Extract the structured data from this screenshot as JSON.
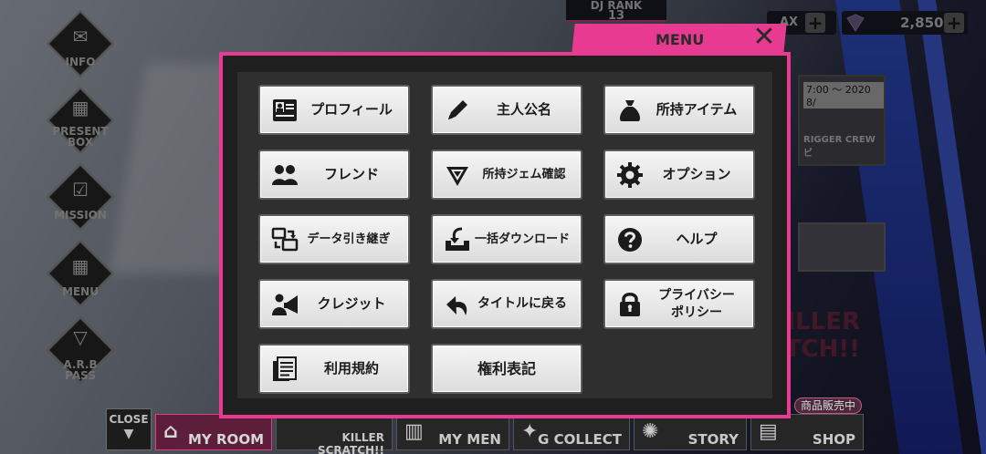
{
  "hud": {
    "dj_rank_label": "DJ RANK",
    "dj_rank_value": "13",
    "stamina_label": "AX",
    "gems": "2,850"
  },
  "side_menu": {
    "info": "INFO",
    "present_box": "PRESENT BOX",
    "mission": "MISSION",
    "menu": "MENU",
    "arb_pass": "A.R.B PASS"
  },
  "bottom_nav": {
    "close": "CLOSE",
    "my_room": "MY ROOM",
    "killer_scratch": "KILLER SCRATCH!!",
    "my_men": "MY MEN",
    "g_collect": "G COLLECT",
    "story": "STORY",
    "shop": "SHOP",
    "sale_badge": "商品販売中"
  },
  "background": {
    "event_time": "7:00 ～ 2020 8/",
    "crew": "RIGGER CREW ビ",
    "killer": "KILLER\nSCRATCH!!"
  },
  "menu": {
    "title": "MENU",
    "buttons": [
      {
        "label": "プロフィール",
        "icon": "id-card-icon"
      },
      {
        "label": "主人公名",
        "icon": "pencil-icon"
      },
      {
        "label": "所持アイテム",
        "icon": "bag-icon"
      },
      {
        "label": "フレンド",
        "icon": "friends-icon"
      },
      {
        "label": "所持ジェム確認",
        "icon": "gem-icon"
      },
      {
        "label": "オプション",
        "icon": "gear-icon"
      },
      {
        "label": "データ引き継ぎ",
        "icon": "data-transfer-icon"
      },
      {
        "label": "一括ダウンロード",
        "icon": "download-icon"
      },
      {
        "label": "ヘルプ",
        "icon": "help-icon"
      },
      {
        "label": "クレジット",
        "icon": "credit-icon"
      },
      {
        "label": "タイトルに戻る",
        "icon": "return-arrow-icon"
      },
      {
        "label": "プライバシー\nポリシー",
        "icon": "lock-icon"
      },
      {
        "label": "利用規約",
        "icon": "document-icon"
      },
      {
        "label": "権利表記",
        "icon": ""
      }
    ]
  }
}
